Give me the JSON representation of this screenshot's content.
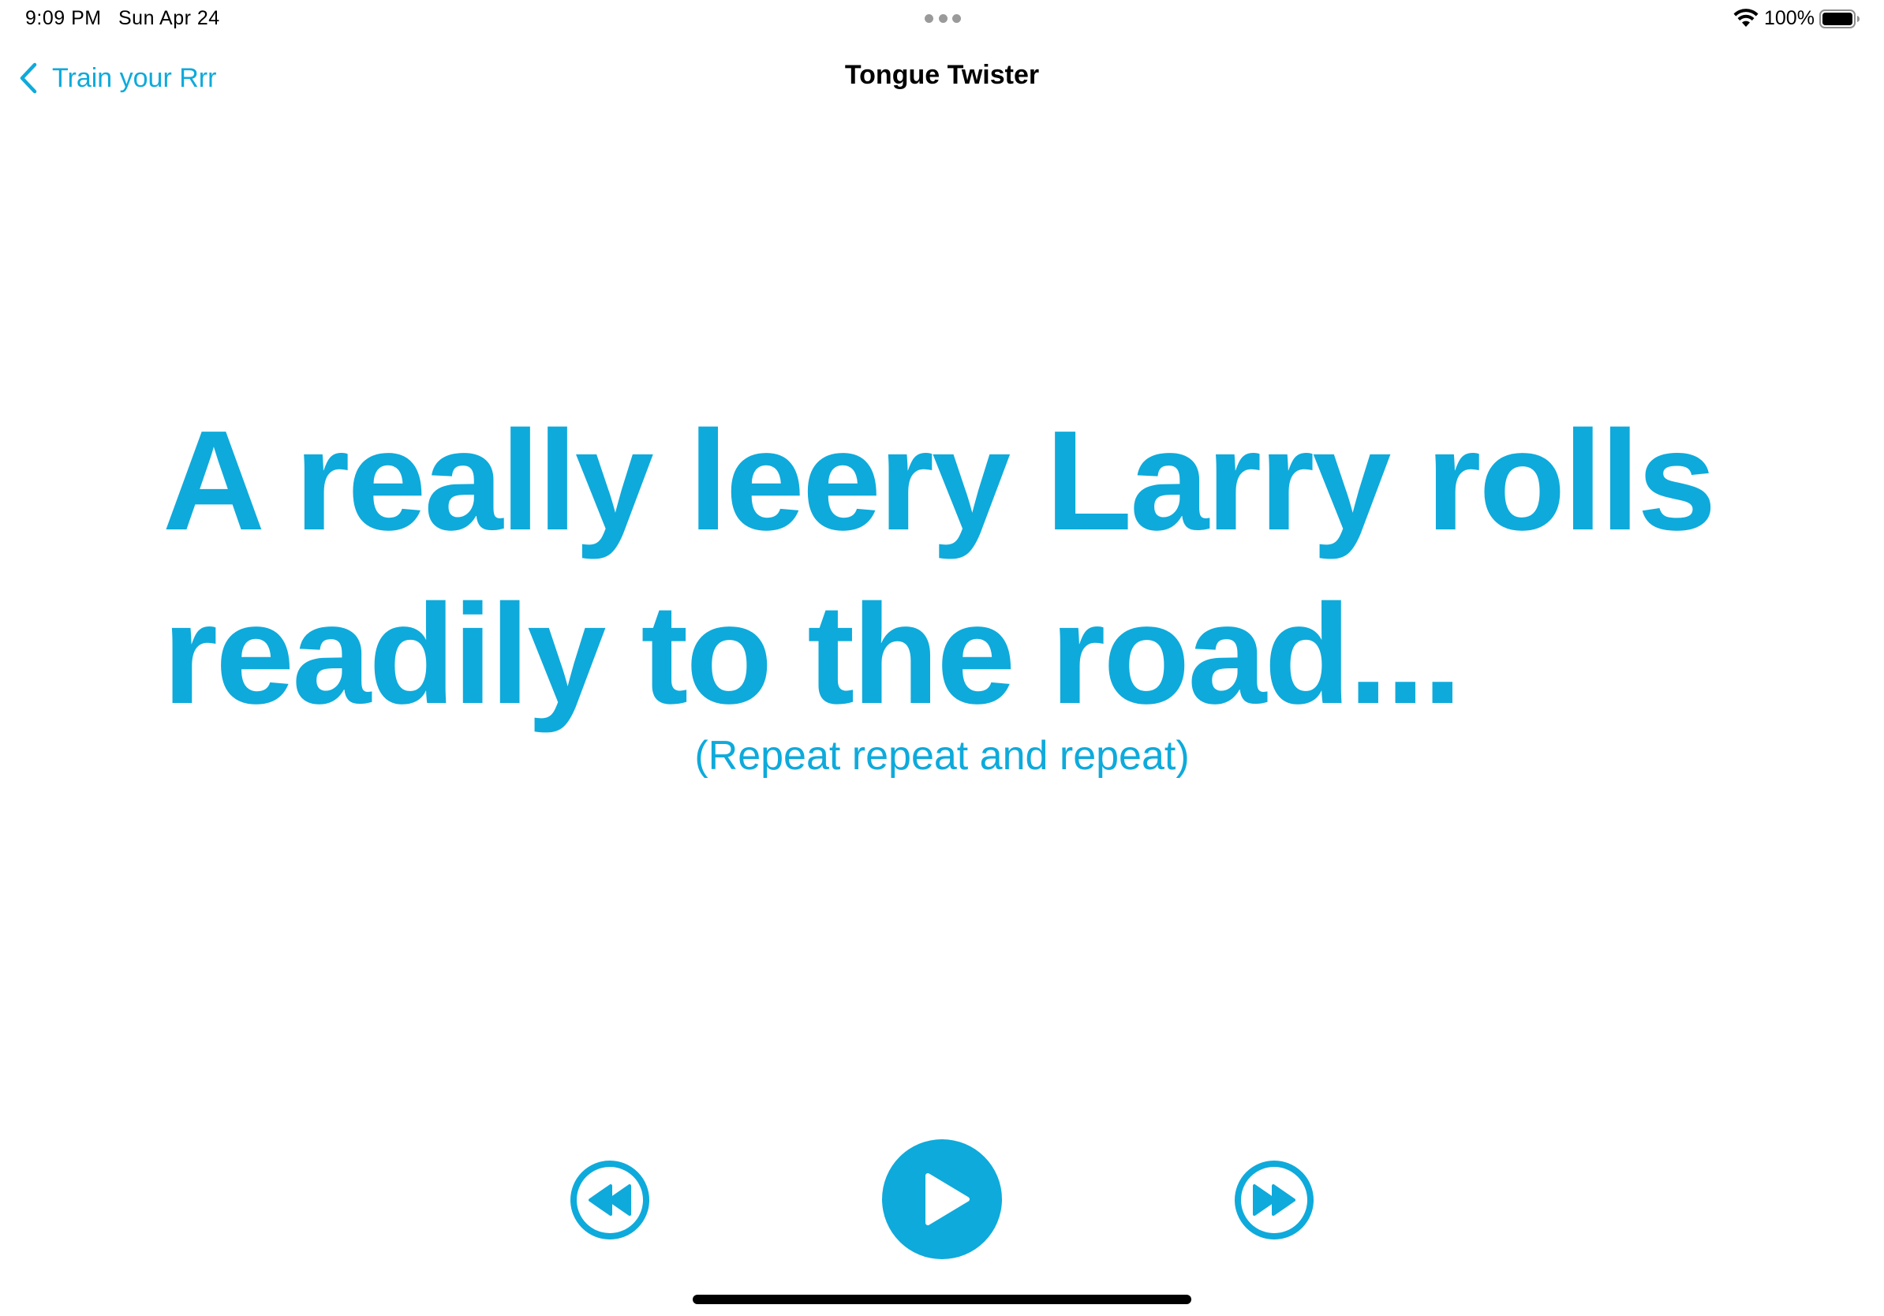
{
  "status_bar": {
    "time": "9:09 PM",
    "date": "Sun Apr 24",
    "battery_percent": "100%",
    "battery_level": 1.0,
    "icons": [
      "wifi-icon",
      "battery-icon",
      "multitask-dots-icon"
    ]
  },
  "nav": {
    "back_label": "Train your Rrr",
    "title": "Tongue Twister",
    "back_icon": "chevron-left-icon"
  },
  "content": {
    "twister_line1": "A really leery Larry rolls",
    "twister_line2": "readily to the road...",
    "repeat_note": "(Repeat repeat and repeat)"
  },
  "controls": {
    "rewind_icon": "rewind-icon",
    "play_icon": "play-icon",
    "forward_icon": "fast-forward-icon"
  },
  "colors": {
    "accent": "#0eaadb",
    "text": "#000000",
    "background": "#ffffff"
  }
}
